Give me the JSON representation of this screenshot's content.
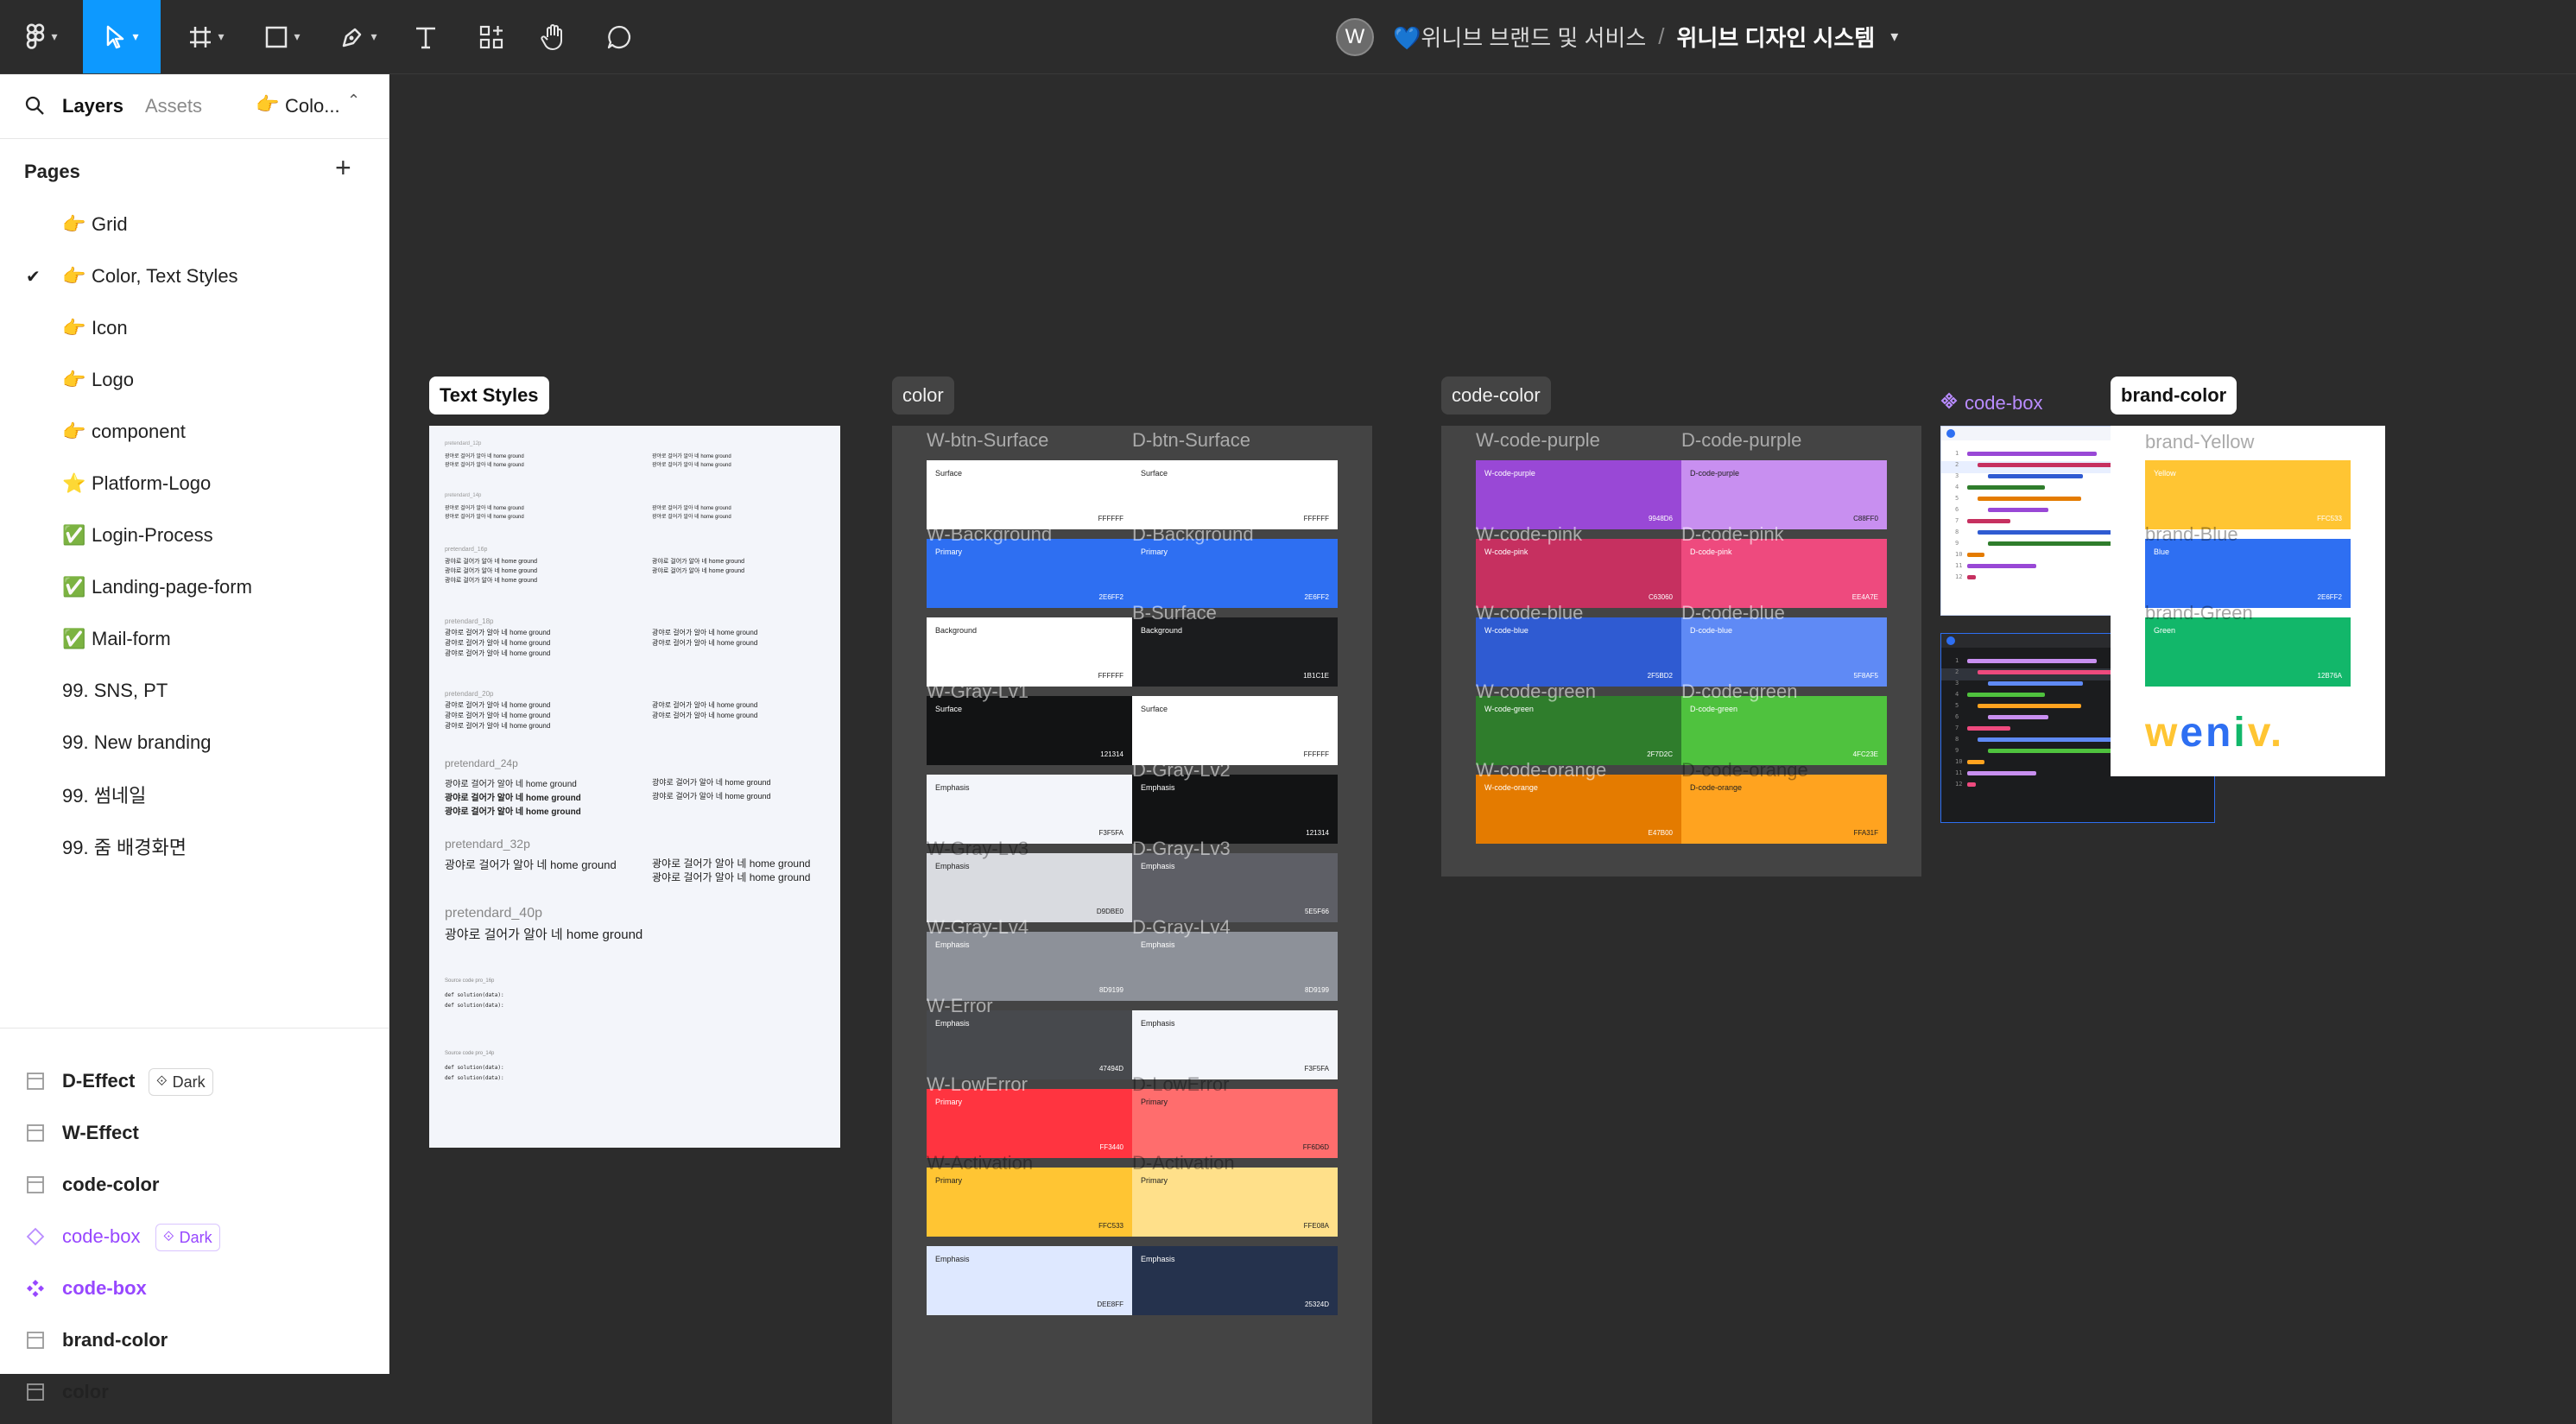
{
  "toolbar": {
    "avatar_letter": "W",
    "project": "💙위니브 브랜드 및 서비스",
    "separator": "/",
    "file": "위니브 디자인 시스템"
  },
  "sidebar": {
    "tabs": [
      "Layers",
      "Assets"
    ],
    "current_page": "Colo...",
    "pages_title": "Pages",
    "pages": [
      {
        "icon": "👉",
        "label": "Grid",
        "checked": false
      },
      {
        "icon": "👉",
        "label": "Color, Text Styles",
        "checked": true
      },
      {
        "icon": "👉",
        "label": "Icon",
        "checked": false
      },
      {
        "icon": "👉",
        "label": "Logo",
        "checked": false
      },
      {
        "icon": "👉",
        "label": "component",
        "checked": false
      },
      {
        "icon": "⭐",
        "label": "Platform-Logo",
        "checked": false
      },
      {
        "icon": "✅",
        "label": "Login-Process",
        "checked": false
      },
      {
        "icon": "✅",
        "label": "Landing-page-form",
        "checked": false
      },
      {
        "icon": "✅",
        "label": "Mail-form",
        "checked": false
      },
      {
        "icon": "",
        "label": "99. SNS, PT",
        "checked": false
      },
      {
        "icon": "",
        "label": "99. New branding",
        "checked": false
      },
      {
        "icon": "",
        "label": "99. 썸네일",
        "checked": false
      },
      {
        "icon": "",
        "label": "99. 줌 배경화면",
        "checked": false
      }
    ],
    "layers": [
      {
        "label": "D-Effect",
        "badge": "Dark",
        "type": "frame"
      },
      {
        "label": "W-Effect",
        "badge": "",
        "type": "frame"
      },
      {
        "label": "code-color",
        "badge": "",
        "type": "frame"
      },
      {
        "label": "code-box",
        "badge": "Dark",
        "type": "instance"
      },
      {
        "label": "code-box",
        "badge": "",
        "type": "component"
      },
      {
        "label": "brand-color",
        "badge": "",
        "type": "frame"
      },
      {
        "label": "color",
        "badge": "",
        "type": "frame"
      }
    ]
  },
  "canvas": {
    "text_styles": {
      "label": "Text Styles",
      "rows": [
        {
          "head": "",
          "sample": "광야로 걸어가 알아 네 home ground"
        },
        {
          "head": "pretendard_24p",
          "sample": "광야로 걸어가 알아 네 home ground"
        },
        {
          "head": "pretendard_32p",
          "sample": "광야로 걸어가 알아 네 home ground"
        },
        {
          "head": "pretendard_40p",
          "sample": "광야로 걸어가 알아 네 home ground"
        }
      ]
    },
    "color": {
      "label": "color",
      "rows": [
        {
          "left_label": "W-btn-Surface",
          "right_label": "D-btn-Surface",
          "left": "#ffffff",
          "right": "#ffffff",
          "left_text": "Surface",
          "right_text": "Surface"
        },
        {
          "left_label": "W-Background",
          "right_label": "D-Background",
          "left": "#2e6ff2",
          "right": "#2e6ff2",
          "left_text": "Primary",
          "right_text": "Primary"
        },
        {
          "left_label": "",
          "right_label": "B-Surface",
          "left": "#ffffff",
          "right": "#1b1c1e",
          "left_text": "Background",
          "right_text": "Background"
        },
        {
          "left_label": "W-Gray-Lv1",
          "right_label": "",
          "left": "#121314",
          "right": "#ffffff",
          "left_text": "Surface",
          "right_text": "Surface"
        },
        {
          "left_label": "",
          "right_label": "D-Gray-Lv2",
          "left": "#f3f5fa",
          "right": "#121314",
          "left_text": "Emphasis",
          "right_text": "Emphasis"
        },
        {
          "left_label": "W-Gray-Lv3",
          "right_label": "D-Gray-Lv3",
          "left": "#d9dbe0",
          "right": "#5e5f66",
          "left_text": "Emphasis",
          "right_text": "Emphasis"
        },
        {
          "left_label": "W-Gray-Lv4",
          "right_label": "D-Gray-Lv4",
          "left": "#8d9199",
          "right": "#8d9199",
          "left_text": "Emphasis",
          "right_text": "Emphasis"
        },
        {
          "left_label": "W-Error",
          "right_label": "",
          "left": "#47494d",
          "right": "#f3f5fa",
          "left_text": "Emphasis",
          "right_text": "Emphasis"
        },
        {
          "left_label": "W-LowError",
          "right_label": "D-LowError",
          "left": "#ff3440",
          "right": "#ff6d6d",
          "left_text": "Primary",
          "right_text": "Primary"
        },
        {
          "left_label": "W-Activation",
          "right_label": "D-Activation",
          "left": "#ffc533",
          "right": "#ffe08a",
          "left_text": "Primary",
          "right_text": "Primary"
        },
        {
          "left_label": "",
          "right_label": "",
          "left": "#dee8ff",
          "right": "#25324d",
          "left_text": "Emphasis",
          "right_text": "Emphasis"
        }
      ]
    },
    "code_color": {
      "label": "code-color",
      "rows": [
        {
          "left_label": "W-code-purple",
          "right_label": "D-code-purple",
          "left": "#9948d6",
          "right": "#c88ff0",
          "left_text": "W-code-purple",
          "right_text": "D-code-purple"
        },
        {
          "left_label": "W-code-pink",
          "right_label": "D-code-pink",
          "left": "#c63060",
          "right": "#ee4a7e",
          "left_text": "W-code-pink",
          "right_text": "D-code-pink"
        },
        {
          "left_label": "W-code-blue",
          "right_label": "D-code-blue",
          "left": "#2f5bd2",
          "right": "#5f8af5",
          "left_text": "W-code-blue",
          "right_text": "D-code-blue"
        },
        {
          "left_label": "W-code-green",
          "right_label": "D-code-green",
          "left": "#2f7d2c",
          "right": "#4fc23e",
          "left_text": "W-code-green",
          "right_text": "D-code-green"
        },
        {
          "left_label": "W-code-orange",
          "right_label": "D-code-orange",
          "left": "#e47b00",
          "right": "#ffa31f",
          "left_text": "W-code-orange",
          "right_text": "D-code-orange"
        }
      ]
    },
    "code_box": {
      "label": "code-box"
    },
    "brand_color": {
      "label": "brand-color",
      "rows": [
        {
          "label": "brand-Yellow",
          "color": "#ffc533",
          "text": "Yellow"
        },
        {
          "label": "brand-Blue",
          "color": "#2e6ff2",
          "text": "Blue"
        },
        {
          "label": "brand-Green",
          "color": "#12b76a",
          "text": "Green"
        }
      ],
      "logo": "weniv."
    }
  },
  "colors": {
    "accent": "#0d99ff",
    "canvas": "#2c2c2c",
    "component": "#9747ff"
  }
}
